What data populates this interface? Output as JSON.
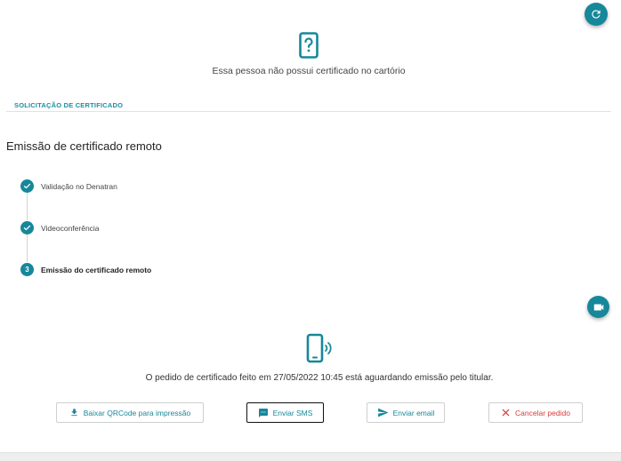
{
  "status": {
    "no_certificate_text": "Essa pessoa não possui certificado no cartório"
  },
  "section": {
    "header": "SOLICITAÇÃO DE CERTIFICADO",
    "title": "Emissão de certificado remoto"
  },
  "steps": [
    {
      "label": "Validação no Denatran",
      "state": "done"
    },
    {
      "label": "Videoconferência",
      "state": "done"
    },
    {
      "label": "Emissão do certificado remoto",
      "state": "current",
      "number": "3"
    }
  ],
  "pending": {
    "message": "O pedido de certificado feito em 27/05/2022 10:45 está aguardando emissão pelo titular."
  },
  "actions": {
    "qrcode_label": "Baixar QRCode para impressão",
    "sms_label": "Enviar SMS",
    "email_label": "Enviar email",
    "cancel_label": "Cancelar pedido"
  },
  "icons": {
    "refresh": "refresh-icon",
    "unknown_phone": "phone-question-icon",
    "video": "video-camera-icon",
    "phone_signal": "phone-signal-icon",
    "download": "download-icon",
    "sms": "message-icon",
    "email": "send-icon",
    "cancel": "close-icon"
  },
  "colors": {
    "accent": "#17879a",
    "danger": "#d93a3a"
  }
}
